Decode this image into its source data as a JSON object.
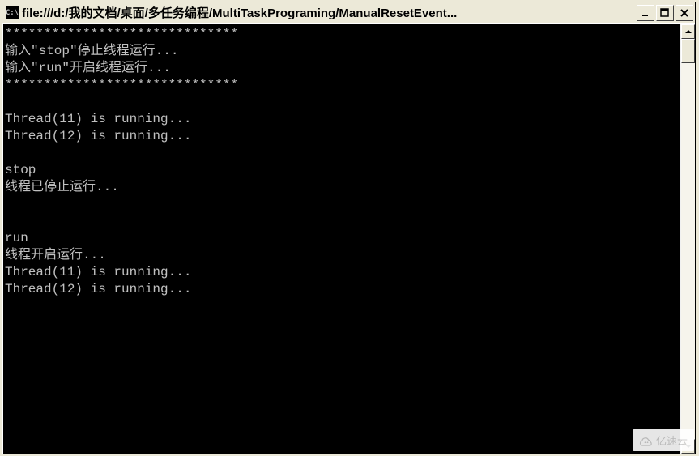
{
  "window": {
    "icon_label": "C:\\",
    "title": "file:///d:/我的文档/桌面/多任务编程/MultiTaskPrograming/ManualResetEvent..."
  },
  "console": {
    "lines": [
      "******************************",
      "输入\"stop\"停止线程运行...",
      "输入\"run\"开启线程运行...",
      "******************************",
      "",
      "Thread(11) is running...",
      "Thread(12) is running...",
      "",
      "stop",
      "线程已停止运行...",
      "",
      "",
      "run",
      "线程开启运行...",
      "Thread(11) is running...",
      "Thread(12) is running..."
    ]
  },
  "watermark": {
    "text": "亿速云"
  }
}
